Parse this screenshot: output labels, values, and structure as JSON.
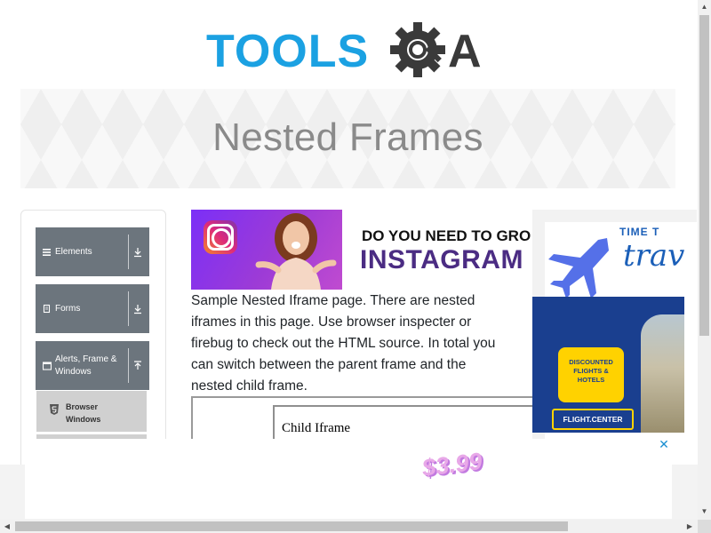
{
  "header": {
    "logo_text_left": "TOOLS",
    "logo_text_right": "A",
    "logo_colors": {
      "blue": "#1ba1e2",
      "dark": "#3a3a3a"
    }
  },
  "banner": {
    "title": "Nested Frames"
  },
  "sidebar": {
    "groups": [
      {
        "label": "Elements",
        "icon": "menu-icon",
        "arrow": "download-arrow-icon"
      },
      {
        "label": "Forms",
        "icon": "document-icon",
        "arrow": "download-arrow-icon"
      },
      {
        "label": "Alerts, Frame & Windows",
        "icon": "window-icon",
        "arrow": "upload-arrow-icon"
      }
    ],
    "subitems": [
      {
        "label": "Browser Windows",
        "icon": "html5-icon"
      }
    ]
  },
  "ads": {
    "instagram": {
      "line1": "DO YOU NEED TO GRO",
      "line2": "INSTAGRAM"
    },
    "travel": {
      "time_text": "TIME T",
      "script_text": "trav",
      "badge_text": "DISCOUNTED FLIGHTS & HOTELS",
      "brand": "FLIGHT.CENTER"
    },
    "bottom": {
      "price": "$3.99",
      "close_icon": "close-icon"
    }
  },
  "content": {
    "description": "Sample Nested Iframe page. There are nested iframes in this page. Use browser inspecter or firebug to check out the HTML source. In total you can switch between the parent frame and the nested child frame.",
    "child_iframe_text": "Child Iframe"
  },
  "colors": {
    "sidebar_group": "#6c757d",
    "sidebar_subitem": "#d0d0d0",
    "banner_title": "#8a8a8a",
    "link_close": "#1a8fd1"
  }
}
